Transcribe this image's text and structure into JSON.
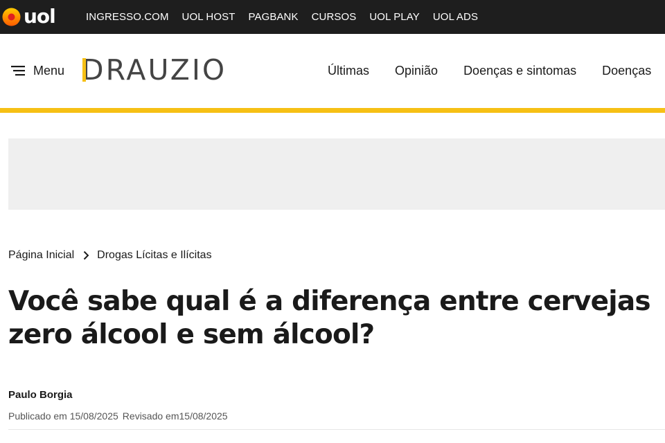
{
  "topbar": {
    "logo_text": "uol",
    "links": [
      "INGRESSO.COM",
      "UOL HOST",
      "PAGBANK",
      "CURSOS",
      "UOL PLAY",
      "UOL ADS"
    ]
  },
  "header": {
    "menu_label": "Menu",
    "brand": "DRAUZIO",
    "nav": [
      "Últimas",
      "Opinião",
      "Doenças e sintomas",
      "Doenças"
    ]
  },
  "breadcrumb": {
    "home": "Página Inicial",
    "category": "Drogas Lícitas e Ilícitas"
  },
  "article": {
    "title": "Você sabe qual é a diferença entre cervejas zero álcool e sem álcool?",
    "author": "Paulo Borgia",
    "published": "Publicado em 15/08/2025",
    "revised": "Revisado em15/08/2025"
  },
  "colors": {
    "topbar_bg": "#1e1e1e",
    "accent_yellow": "#f6c015",
    "ad_placeholder": "#efefef"
  }
}
